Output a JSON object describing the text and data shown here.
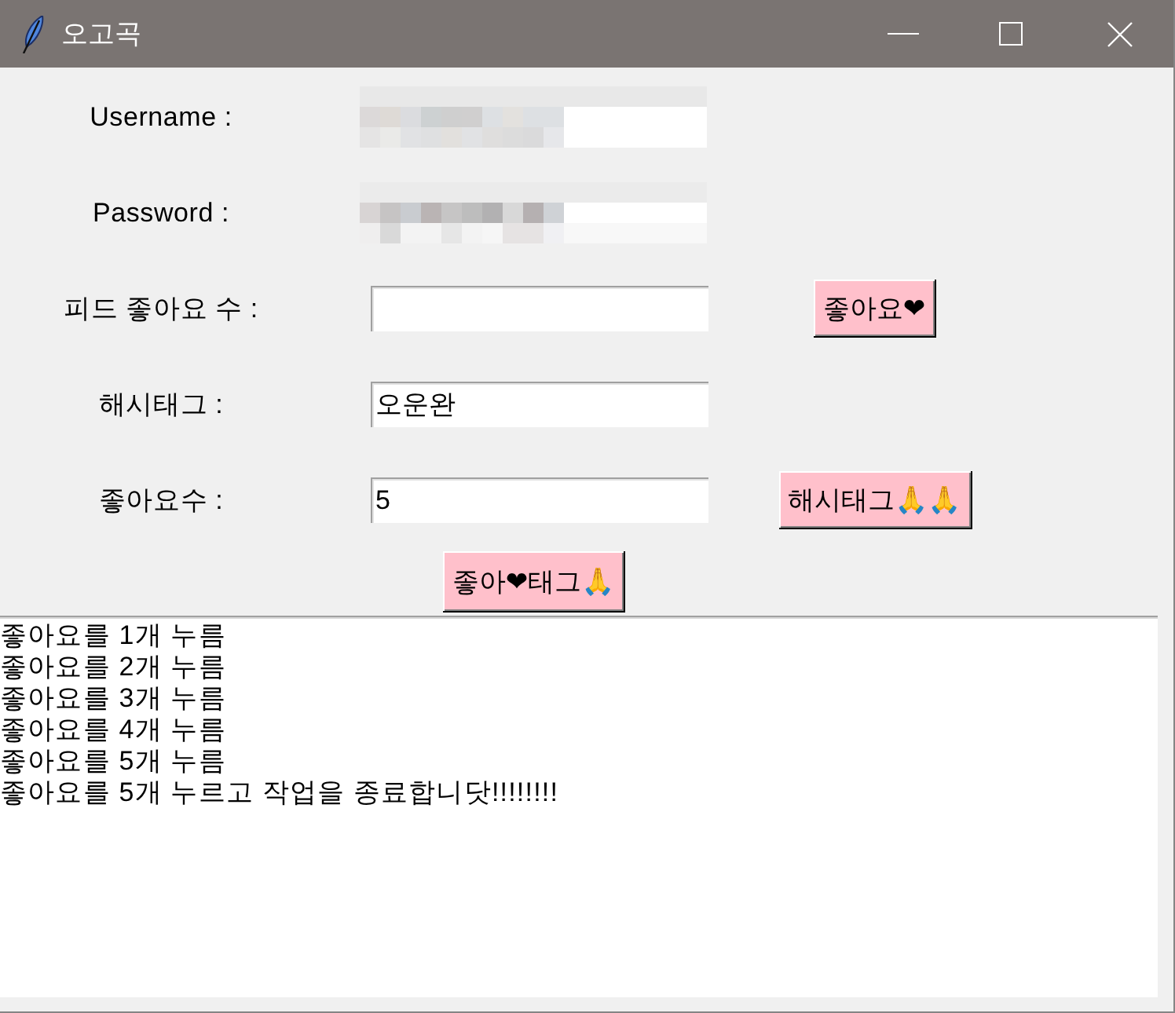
{
  "window": {
    "title": "오고곡"
  },
  "form": {
    "rows": [
      {
        "label": "Username :",
        "field": {
          "blurred": true
        }
      },
      {
        "label": "Password :",
        "field": {
          "blurred": true
        }
      },
      {
        "label": "피드 좋아요 수 :",
        "field": {
          "blurred": false
        },
        "button": "좋아요❤"
      },
      {
        "label": "해시태그 :",
        "field": {
          "blurred": false,
          "value": "오운완"
        }
      },
      {
        "label": "좋아요수 :",
        "field": {
          "blurred": false,
          "value": "5"
        },
        "button": "해시태그🙏🙏"
      }
    ],
    "bottom_button": "좋아❤태그🙏"
  },
  "log": {
    "lines": [
      "좋아요를 1개 누름",
      "좋아요를 2개 누름",
      "좋아요를 3개 누름",
      "좋아요를 4개 누름",
      "좋아요를 5개 누름",
      "좋아요를 5개 누르고 작업을 종료합니닷!!!!!!!!"
    ]
  }
}
